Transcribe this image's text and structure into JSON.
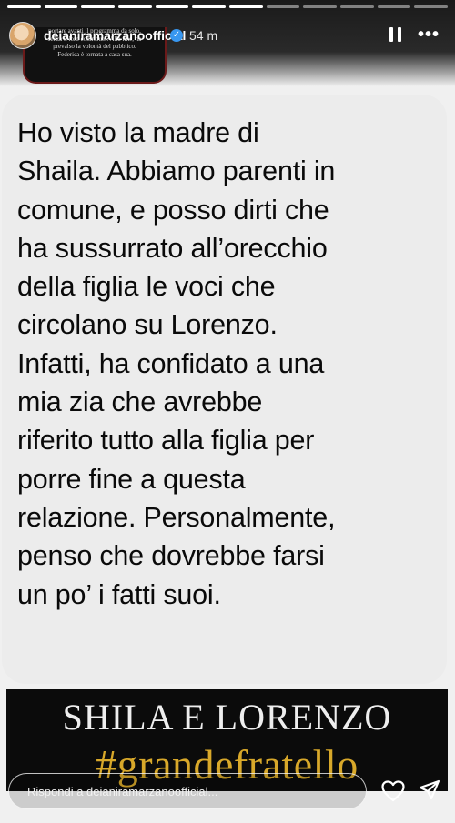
{
  "header": {
    "username": "deianiramarzanoofficial",
    "verified_mark": "✓",
    "time": "54 m",
    "pause_icon": "pause-icon",
    "more_icon": "more-icon",
    "more_glyph": "•••"
  },
  "clip": {
    "lines": [
      "portare avanti il programma da solo,",
      "senza il loro contributo. Alla fine, ha",
      "prevalso la volontà del pubblico.",
      "Federica è tornata a casa sua."
    ]
  },
  "message": {
    "lines": [
      "Ho visto la madre di",
      "Shaila. Abbiamo parenti in",
      "comune, e posso dirti che",
      "ha sussurrato all’orecchio",
      "della figlia le voci che",
      "circolano su Lorenzo.",
      "Infatti, ha confidato a una",
      "mia zia che avrebbe",
      "riferito tutto alla figlia per",
      "porre fine a questa",
      "relazione. Personalmente,",
      "penso che dovrebbe farsi",
      "un po’ i fatti suoi."
    ]
  },
  "banner": {
    "title": "SHILA E LORENZO",
    "hashtag": "#grandefratello",
    "hashtag_color": "#d8a82a"
  },
  "reply": {
    "placeholder": "Rispondi a deianiramarzanoofficial...",
    "like_icon": "heart-icon",
    "send_icon": "send-icon"
  },
  "colors": {
    "bubble": "#ececec",
    "banner_bg": "#0b0b0b",
    "verified": "#3897f0"
  }
}
